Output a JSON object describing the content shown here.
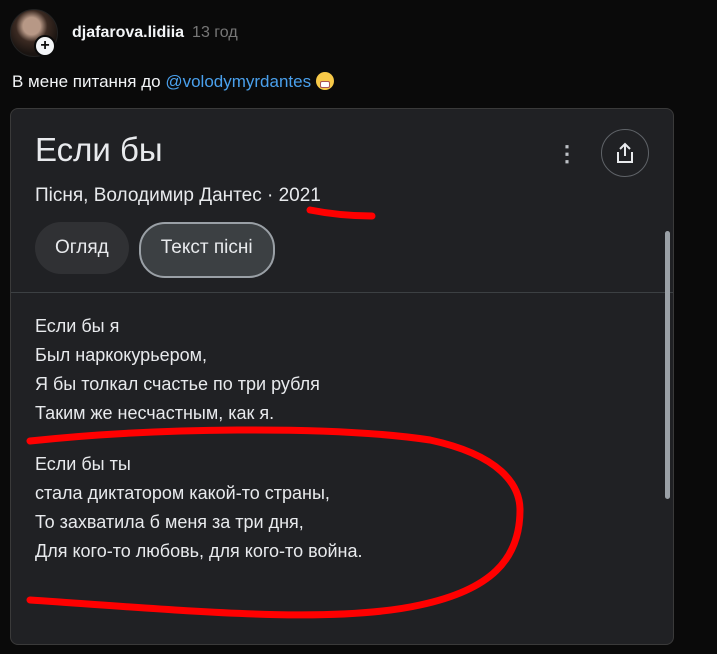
{
  "post": {
    "username": "djafarova.lidiia",
    "time": "13 год",
    "caption_text": "В мене питання до ",
    "mention": "@volodymyrdantes"
  },
  "card": {
    "title": "Если бы",
    "meta_prefix": "Пісня, Володимир Дантес · ",
    "year": "2021",
    "more_icon": "⋮",
    "tabs": [
      {
        "label": "Огляд",
        "active": false
      },
      {
        "label": "Текст пісні",
        "active": true
      }
    ],
    "lyrics": {
      "stanza1": [
        "Если бы я",
        "Был наркокурьером,",
        "Я бы толкал счастье по три рубля",
        "Таким же несчастным, как я."
      ],
      "stanza2": [
        "Если бы ты",
        "стала диктатором какой-то страны,",
        "То захватила б меня за три дня,",
        "Для кого-то любовь, для кого-то война."
      ]
    }
  },
  "colors": {
    "accent_link": "#4aa0ec",
    "annotation_red": "#ff0000",
    "card_bg": "#202124"
  }
}
